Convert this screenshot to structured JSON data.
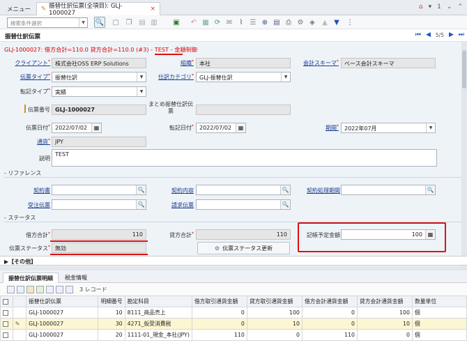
{
  "tabs": {
    "menu": "メニュー",
    "active": "振替仕訳伝票(全項目): GLJ-1000027",
    "close": "×"
  },
  "top_right": {
    "count": "1"
  },
  "search": {
    "placeholder": "検索条件選択"
  },
  "window": {
    "title": "振替仕訳伝票",
    "record_pos": "5/5"
  },
  "status_line": {
    "text": "GLJ-1000027: 借方合計=110.0 貸方合計=110.0 (#3) - TEST - ",
    "suffix": "金額制御"
  },
  "fields": {
    "client_label": "クライアント",
    "client": "株式会社OSS ERP Solutions",
    "org_label": "組織",
    "org": "本社",
    "schema_label": "会計スキーマ",
    "schema": "ベース会計スキーマ",
    "doctype_label": "伝票タイプ",
    "doctype": "振替仕訳",
    "category_label": "仕訳カテゴリ",
    "category": "GLJ-振替仕訳",
    "posttype_label": "転記タイプ",
    "posttype": "実績",
    "docno_label": "伝票番号",
    "docno": "GLJ-1000027",
    "batch_label": "まとめ振替仕訳伝票",
    "batch": "",
    "docdate_label": "伝票日付",
    "docdate": "2022/07/02",
    "acctdate_label": "転記日付",
    "acctdate": "2022/07/02",
    "period_label": "期間",
    "period": "2022年07月",
    "currency_label": "通貨",
    "currency": "JPY",
    "desc_label": "説明",
    "desc": "TEST"
  },
  "ref": {
    "section": "- リファレンス",
    "contract_label": "契約書",
    "content_label": "契約内容",
    "proc_label": "契約処理期間",
    "order_label": "受注伝票",
    "invoice_label": "請求伝票"
  },
  "status": {
    "section": "- ステータス",
    "debit_label": "借方合計",
    "debit": "110",
    "credit_label": "貸方合計",
    "credit": "110",
    "planned_label": "記帳予定金額",
    "planned": "100",
    "docstatus_label": "伝票ステータス",
    "docstatus": "無効",
    "update_button": "伝票ステータス更新"
  },
  "other": {
    "label": "▶【その他】"
  },
  "lower_tabs": [
    "振替仕訳伝票明細",
    "税金情報"
  ],
  "grid": {
    "record_count": "3 レコード",
    "columns": [
      "振替仕訳伝票",
      "明細番号",
      "勘定科目",
      "借方取引通貨金額",
      "貸方取引通貨金額",
      "借方会計通貨金額",
      "貸方会計通貨金額",
      "数量単位"
    ],
    "rows": [
      [
        "GLJ-1000027",
        "10",
        "8111_商品売上",
        "0",
        "100",
        "0",
        "100",
        "個"
      ],
      [
        "GLJ-1000027",
        "30",
        "4271_仮受消費税",
        "0",
        "10",
        "0",
        "10",
        "個"
      ],
      [
        "GLJ-1000027",
        "20",
        "1111-01_現金_本社(JPY)",
        "110",
        "0",
        "110",
        "0",
        "個"
      ]
    ]
  }
}
